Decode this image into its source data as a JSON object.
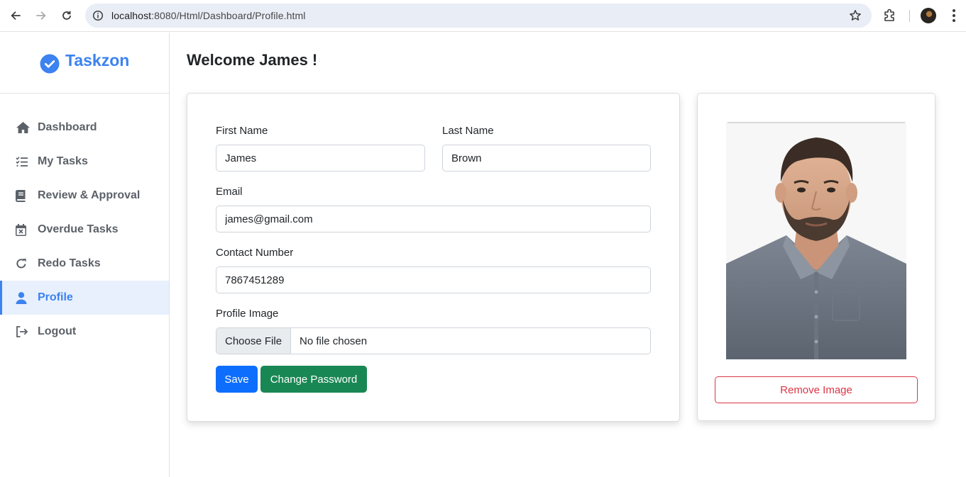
{
  "browser": {
    "url_host": "localhost",
    "url_path": ":8080/Html/Dashboard/Profile.html"
  },
  "sidebar": {
    "brand": "Taskzon",
    "items": [
      {
        "label": "Dashboard",
        "icon": "home-icon"
      },
      {
        "label": "My Tasks",
        "icon": "task-list-icon"
      },
      {
        "label": "Review & Approval",
        "icon": "book-icon"
      },
      {
        "label": "Overdue Tasks",
        "icon": "calendar-x-icon"
      },
      {
        "label": "Redo Tasks",
        "icon": "redo-icon"
      },
      {
        "label": "Profile",
        "icon": "user-icon",
        "active": true
      },
      {
        "label": "Logout",
        "icon": "logout-icon"
      }
    ]
  },
  "main": {
    "welcome": "Welcome James !"
  },
  "form": {
    "first_name_label": "First Name",
    "first_name_value": "James",
    "last_name_label": "Last Name",
    "last_name_value": "Brown",
    "email_label": "Email",
    "email_value": "james@gmail.com",
    "contact_label": "Contact Number",
    "contact_value": "7867451289",
    "image_label": "Profile Image",
    "choose_file": "Choose File",
    "no_file": "No file chosen",
    "save": "Save",
    "change_password": "Change Password"
  },
  "image_card": {
    "remove": "Remove Image"
  },
  "colors": {
    "accent": "#3c82f0",
    "primary": "#0d6efd",
    "success": "#198754",
    "danger": "#dc3545"
  }
}
